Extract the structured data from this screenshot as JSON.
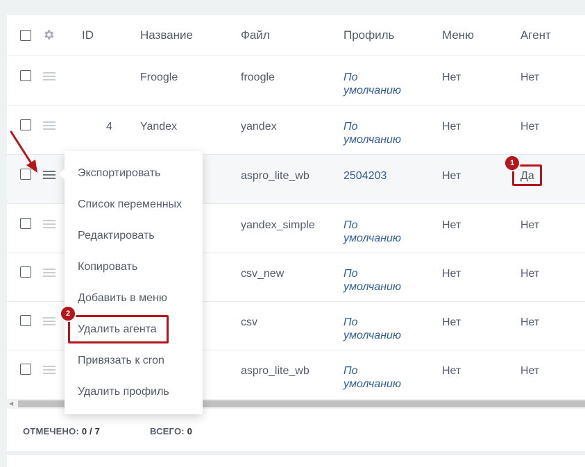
{
  "table": {
    "headers": {
      "id": "ID",
      "name": "Название",
      "file": "Файл",
      "profile": "Профиль",
      "menu": "Меню",
      "agent": "Агент"
    },
    "rows": [
      {
        "id": "",
        "name": "Froogle",
        "file": "froogle",
        "profile_line1": "По",
        "profile_line2": "умолчанию",
        "menu": "Нет",
        "agent": "Нет"
      },
      {
        "id": "4",
        "name": "Yandex",
        "file": "yandex",
        "profile_line1": "По",
        "profile_line2": "умолчанию",
        "menu": "Нет",
        "agent": "Нет"
      },
      {
        "id": "",
        "name": "",
        "file": "aspro_lite_wb",
        "profile_number": "2504203",
        "menu": "Нет",
        "agent": "Да"
      },
      {
        "id": "",
        "name": "",
        "file": "yandex_simple",
        "profile_line1": "По",
        "profile_line2": "умолчанию",
        "menu": "Нет",
        "agent": "Нет"
      },
      {
        "id": "",
        "name": "",
        "file": "csv_new",
        "profile_line1": "По",
        "profile_line2": "умолчанию",
        "menu": "Нет",
        "agent": "Нет"
      },
      {
        "id": "",
        "name": "",
        "file": "csv",
        "profile_line1": "По",
        "profile_line2": "умолчанию",
        "menu": "Нет",
        "agent": "Нет"
      },
      {
        "id": "",
        "name": "",
        "file": "aspro_lite_wb",
        "profile_line1": "По",
        "profile_line2": "умолчанию",
        "menu": "Нет",
        "agent": "Нет"
      }
    ]
  },
  "context_menu": {
    "items": [
      "Экспортировать",
      "Список переменных",
      "Редактировать",
      "Копировать",
      "Добавить в меню",
      "Удалить агента",
      "Привязать к cron",
      "Удалить профиль"
    ]
  },
  "annotations": {
    "badge1": "1",
    "badge2": "2",
    "accent_color": "#b5151b"
  },
  "footer": {
    "checked_label": "ОТМЕЧЕНО:",
    "checked_value": "0 / 7",
    "total_label": "ВСЕГО:",
    "total_value": "0"
  },
  "icons": {
    "settings": "gear-icon",
    "row_menu": "hamburger-icon",
    "scroll_left": "scroll-left-arrow"
  },
  "colors": {
    "link": "#2f5d9e",
    "text": "#535c69",
    "annotation": "#b5151b"
  }
}
